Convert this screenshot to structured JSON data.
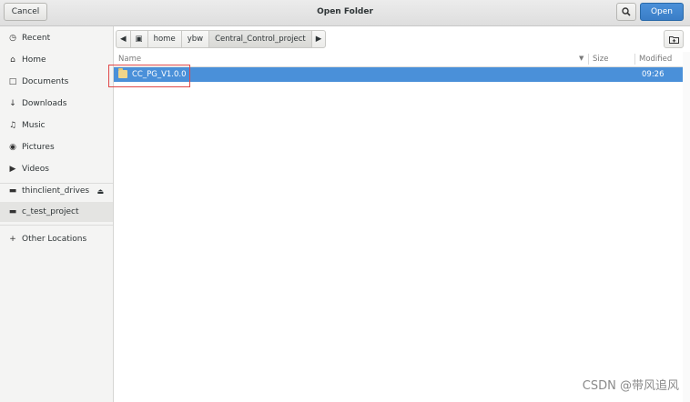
{
  "header": {
    "cancel": "Cancel",
    "title": "Open Folder",
    "open": "Open",
    "search_icon": "search-icon"
  },
  "sidebar": {
    "items": [
      {
        "label": "Recent",
        "icon": "recent-icon"
      },
      {
        "label": "Home",
        "icon": "home-icon"
      },
      {
        "label": "Documents",
        "icon": "documents-icon"
      },
      {
        "label": "Downloads",
        "icon": "downloads-icon"
      },
      {
        "label": "Music",
        "icon": "music-icon"
      },
      {
        "label": "Pictures",
        "icon": "pictures-icon"
      },
      {
        "label": "Videos",
        "icon": "videos-icon"
      },
      {
        "label": "thinclient_drives",
        "icon": "drive-icon"
      },
      {
        "label": "c_test_project",
        "icon": "folder-icon"
      },
      {
        "label": "Other Locations",
        "icon": "plus-icon"
      }
    ]
  },
  "path": [
    "home",
    "ybw",
    "Central_Control_project"
  ],
  "columns": {
    "name": "Name",
    "size": "Size",
    "modified": "Modified"
  },
  "files": [
    {
      "name": "CC_PG_V1.0.0",
      "size": "",
      "modified": "09:26"
    }
  ],
  "watermark": "CSDN @带风追风"
}
